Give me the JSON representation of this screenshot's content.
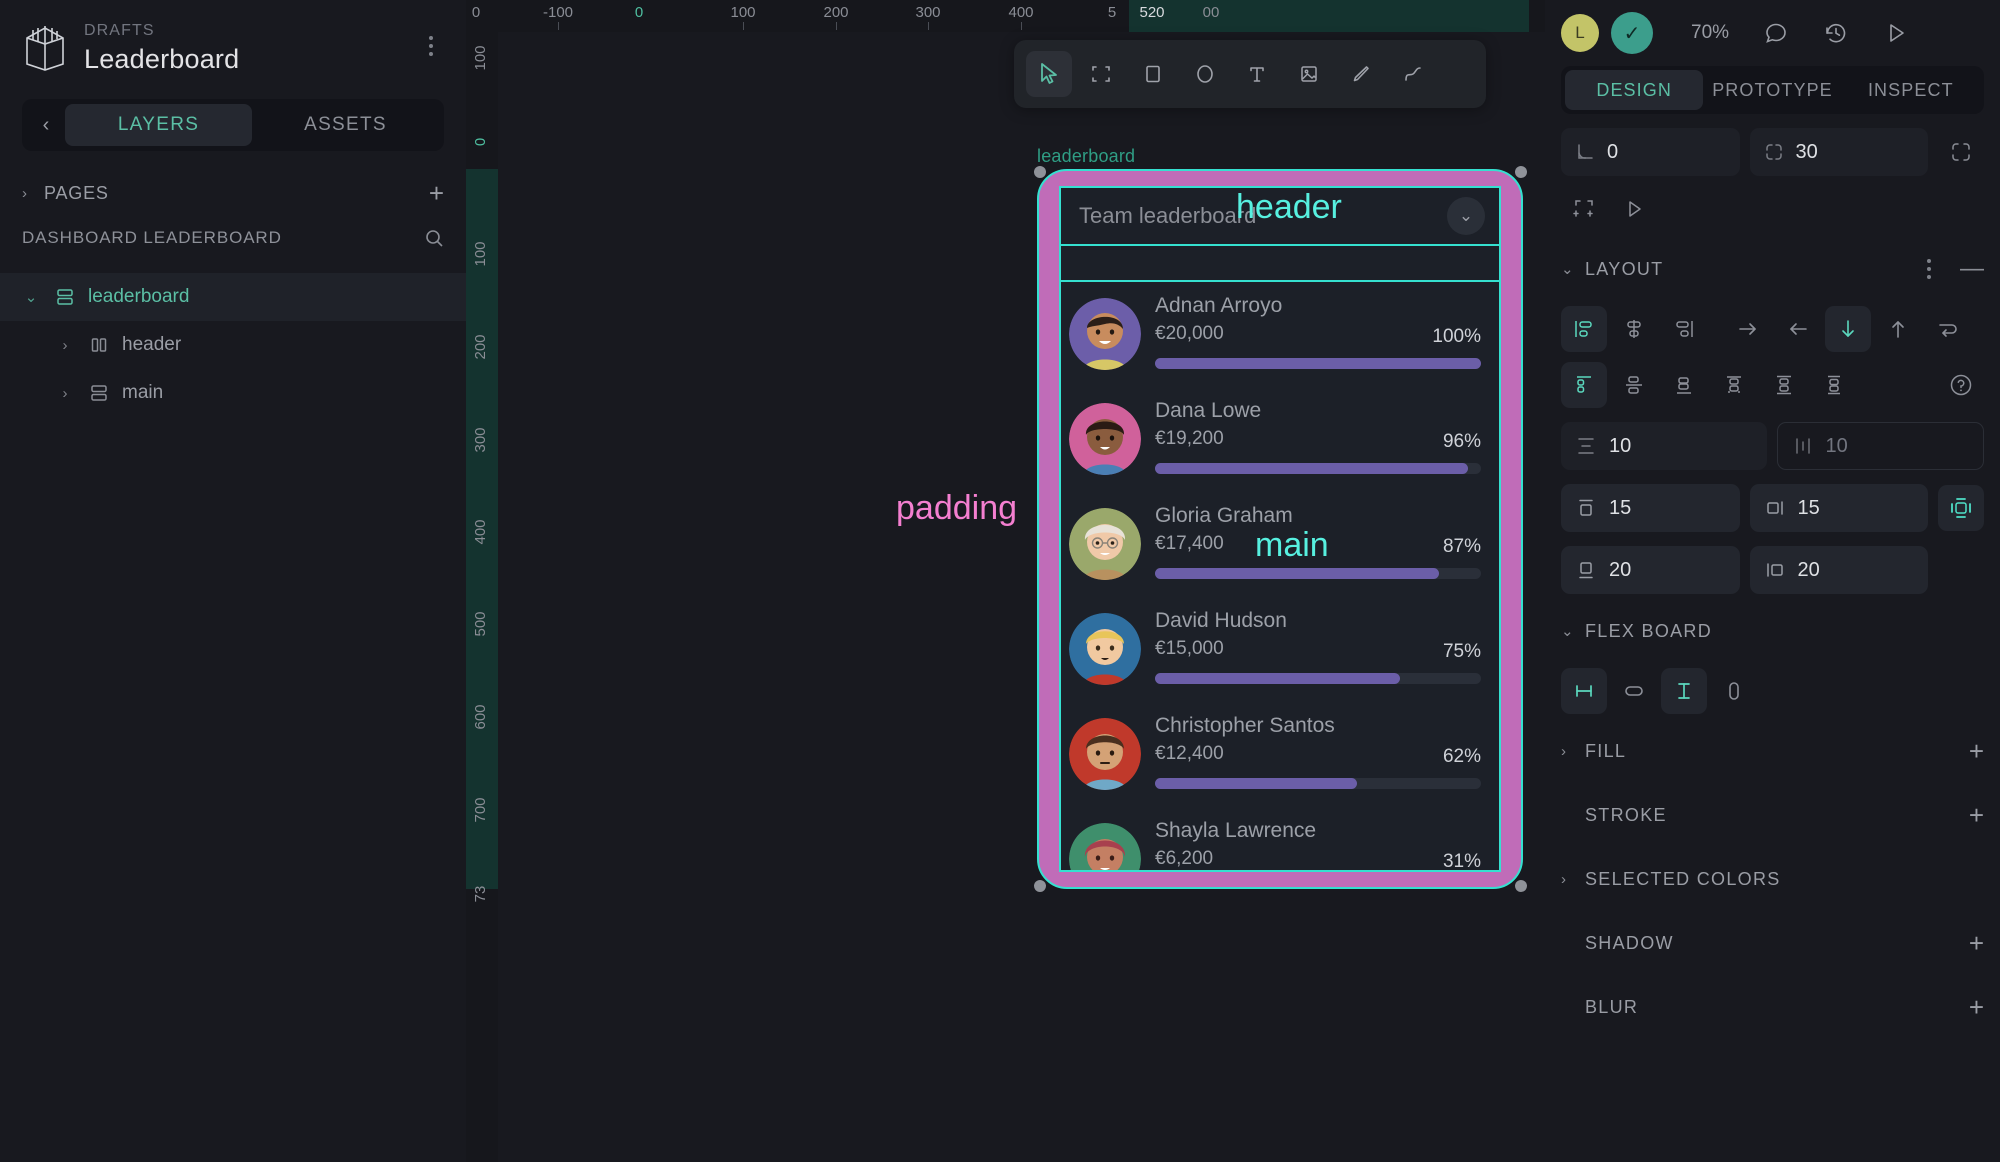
{
  "left": {
    "drafts_label": "DRAFTS",
    "file_name": "Leaderboard",
    "tabs": [
      {
        "label": "LAYERS",
        "active": true
      },
      {
        "label": "ASSETS",
        "active": false
      }
    ],
    "pages_label": "PAGES",
    "page_item": "DASHBOARD LEADERBOARD",
    "layers": [
      {
        "label": "leaderboard",
        "selected": true,
        "depth": 0,
        "twist": "chevron-down"
      },
      {
        "label": "header",
        "selected": false,
        "depth": 1,
        "twist": "chevron-right"
      },
      {
        "label": "main",
        "selected": false,
        "depth": 1,
        "twist": "chevron-right"
      }
    ]
  },
  "canvas": {
    "ruler_h": [
      "0",
      "-100",
      "0",
      "100",
      "200",
      "300",
      "400",
      "5",
      "520",
      "00"
    ],
    "ruler_v": [
      "100",
      "0",
      "100",
      "200",
      "300",
      "400",
      "500",
      "600",
      "700",
      "73"
    ],
    "tools": [
      {
        "name": "pointer-tool",
        "active": true
      },
      {
        "name": "frame-tool",
        "active": false
      },
      {
        "name": "rect-tool",
        "active": false
      },
      {
        "name": "ellipse-tool",
        "active": false
      },
      {
        "name": "text-tool",
        "active": false
      },
      {
        "name": "image-tool",
        "active": false
      },
      {
        "name": "pen-tool",
        "active": false
      },
      {
        "name": "path-tool",
        "active": false
      }
    ],
    "board_name": "leaderboard",
    "overlays": {
      "header": "header",
      "main": "main",
      "padding": "padding"
    },
    "card": {
      "title": "Team leaderboard",
      "rows": [
        {
          "name": "Adnan Arroyo",
          "amount": "€20,000",
          "percent": "100%",
          "value": 100,
          "bg": "#6c5ea9",
          "skin": "#c88c5e",
          "hair": "#2c1f18",
          "shirt": "#d6c766"
        },
        {
          "name": "Dana Lowe",
          "amount": "€19,200",
          "percent": "96%",
          "value": 96,
          "bg": "#d0619b",
          "skin": "#8a5c3e",
          "hair": "#2a1b14",
          "shirt": "#4a7fb5"
        },
        {
          "name": "Gloria Graham",
          "amount": "€17,400",
          "percent": "87%",
          "value": 87,
          "bg": "#9aa86b",
          "skin": "#f0c9a8",
          "hair": "#e8e2d8",
          "shirt": "#b8915f"
        },
        {
          "name": "David Hudson",
          "amount": "€15,000",
          "percent": "75%",
          "value": 75,
          "bg": "#2f6fa0",
          "skin": "#f1c9a0",
          "hair": "#e8c55a",
          "shirt": "#c0392b"
        },
        {
          "name": "Christopher Santos",
          "amount": "€12,400",
          "percent": "62%",
          "value": 62,
          "bg": "#c0392b",
          "skin": "#d4a276",
          "hair": "#4a2f1e",
          "shirt": "#6fa8c7"
        },
        {
          "name": "Shayla Lawrence",
          "amount": "€6,200",
          "percent": "31%",
          "value": 31,
          "bg": "#3f8f6c",
          "skin": "#c47f63",
          "hair": "#a8404e",
          "shirt": "#e0716b"
        }
      ]
    }
  },
  "right": {
    "avatar_initial": "L",
    "zoom": "70%",
    "tabs": [
      {
        "label": "DESIGN",
        "active": true
      },
      {
        "label": "PROTOTYPE",
        "active": false
      },
      {
        "label": "INSPECT",
        "active": false
      }
    ],
    "rotation": "0",
    "radius": "30",
    "layout": {
      "title": "LAYOUT",
      "align_items": [
        {
          "name": "align-start",
          "active": true
        },
        {
          "name": "align-center",
          "active": false
        },
        {
          "name": "align-end",
          "active": false
        }
      ],
      "directions": [
        {
          "name": "direction-row",
          "active": false
        },
        {
          "name": "direction-row-reverse",
          "active": false
        },
        {
          "name": "direction-column",
          "active": true
        },
        {
          "name": "direction-column-reverse",
          "active": false
        },
        {
          "name": "direction-wrap",
          "active": false
        }
      ],
      "justify": [
        {
          "name": "justify-start",
          "active": true
        },
        {
          "name": "justify-center",
          "active": false
        },
        {
          "name": "justify-end",
          "active": false
        },
        {
          "name": "justify-space-between",
          "active": false
        },
        {
          "name": "justify-space-around",
          "active": false
        },
        {
          "name": "justify-space-evenly",
          "active": false
        }
      ],
      "row_gap": "10",
      "column_gap": "10",
      "padding_top": "15",
      "padding_right": "15",
      "padding_bottom": "20",
      "padding_left": "20"
    },
    "flex_board": {
      "title": "FLEX BOARD",
      "options": [
        {
          "name": "fix-width",
          "active": true
        },
        {
          "name": "hug-content",
          "active": false
        },
        {
          "name": "fill-height",
          "active": true
        },
        {
          "name": "auto-height",
          "active": false
        }
      ]
    },
    "sections": [
      {
        "title": "FILL",
        "collapsible": true,
        "plus": true
      },
      {
        "title": "STROKE",
        "collapsible": false,
        "plus": true
      },
      {
        "title": "SELECTED COLORS",
        "collapsible": true,
        "plus": false
      },
      {
        "title": "SHADOW",
        "collapsible": false,
        "plus": true
      },
      {
        "title": "BLUR",
        "collapsible": false,
        "plus": true
      }
    ]
  },
  "colors": {
    "accent_teal": "#5bbfa5",
    "selection_cyan": "#35e0d0",
    "padding_pink": "#c06cb8",
    "bar_purple": "#6b5ea8",
    "panel_bg": "#18191f"
  }
}
